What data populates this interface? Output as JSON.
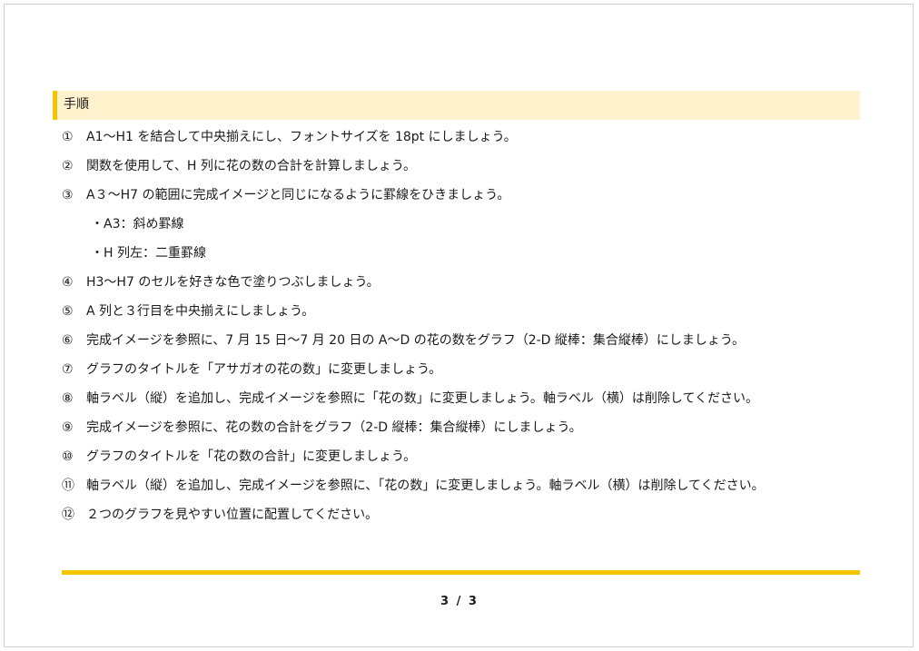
{
  "section": {
    "title": "手順"
  },
  "steps": [
    {
      "num": "①",
      "text": "A1～H1 を結合して中央揃えにし、フォントサイズを 18pt にしましょう。"
    },
    {
      "num": "②",
      "text": "関数を使用して、H 列に花の数の合計を計算しましょう。"
    },
    {
      "num": "③",
      "text": "A３～H7 の範囲に完成イメージと同じになるように罫線をひきましょう。"
    },
    {
      "num": "",
      "text": "・A3：斜め罫線"
    },
    {
      "num": "",
      "text": "・H 列左：二重罫線"
    },
    {
      "num": "④",
      "text": "H3～H7 のセルを好きな色で塗りつぶしましょう。"
    },
    {
      "num": "⑤",
      "text": "A 列と３行目を中央揃えにしましょう。"
    },
    {
      "num": "⑥",
      "text": "完成イメージを参照に、7 月 15 日～7 月 20 日の A～D の花の数をグラフ（2-D 縦棒：集合縦棒）にしましょう。"
    },
    {
      "num": "⑦",
      "text": "グラフのタイトルを「アサガオの花の数」に変更しましょう。"
    },
    {
      "num": "⑧",
      "text": "軸ラベル（縦）を追加し、完成イメージを参照に「花の数」に変更しましょう。軸ラベル（横）は削除してください。"
    },
    {
      "num": "⑨",
      "text": "完成イメージを参照に、花の数の合計をグラフ（2-D 縦棒：集合縦棒）にしましょう。"
    },
    {
      "num": "⑩",
      "text": "グラフのタイトルを「花の数の合計」に変更しましょう。"
    },
    {
      "num": "⑪",
      "text": "軸ラベル（縦）を追加し、完成イメージを参照に、「花の数」に変更しましょう。軸ラベル（横）は削除してください。"
    },
    {
      "num": "⑫",
      "text": "２つのグラフを見やすい位置に配置してください。"
    }
  ],
  "footer": {
    "page_number": "3 / 3"
  },
  "colors": {
    "accent": "#f5c400",
    "header_background": "#fff2cc"
  }
}
